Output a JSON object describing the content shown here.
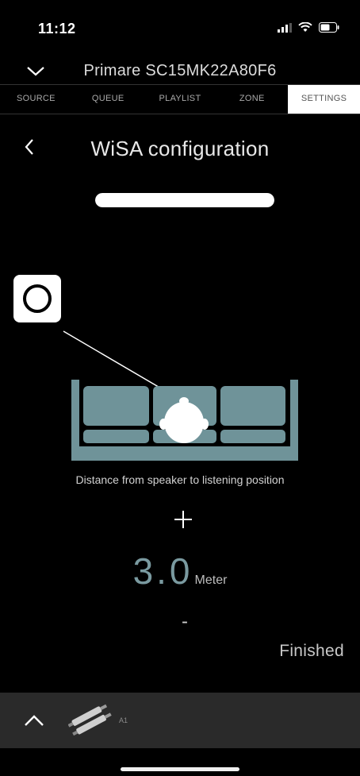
{
  "status_bar": {
    "time": "11:12"
  },
  "device": {
    "name": "Primare SC15MK22A80F6"
  },
  "tabs": [
    {
      "label": "SOURCE",
      "active": false
    },
    {
      "label": "QUEUE",
      "active": false
    },
    {
      "label": "PLAYLIST",
      "active": false
    },
    {
      "label": "ZONE",
      "active": false
    },
    {
      "label": "SETTINGS",
      "active": true
    }
  ],
  "page": {
    "title": "WiSA configuration"
  },
  "progress": {
    "fraction": 1.0
  },
  "distance": {
    "label": "Distance from speaker to listening position",
    "plus": "+",
    "value": "3.0",
    "unit": "Meter",
    "minus": "-"
  },
  "actions": {
    "finished": "Finished"
  },
  "bottom_bar": {
    "source_label": "A1"
  },
  "colors": {
    "accent": "#7a9aa0",
    "sofa": "#6f9399",
    "background": "#000000",
    "bar": "#2a2a2a"
  }
}
